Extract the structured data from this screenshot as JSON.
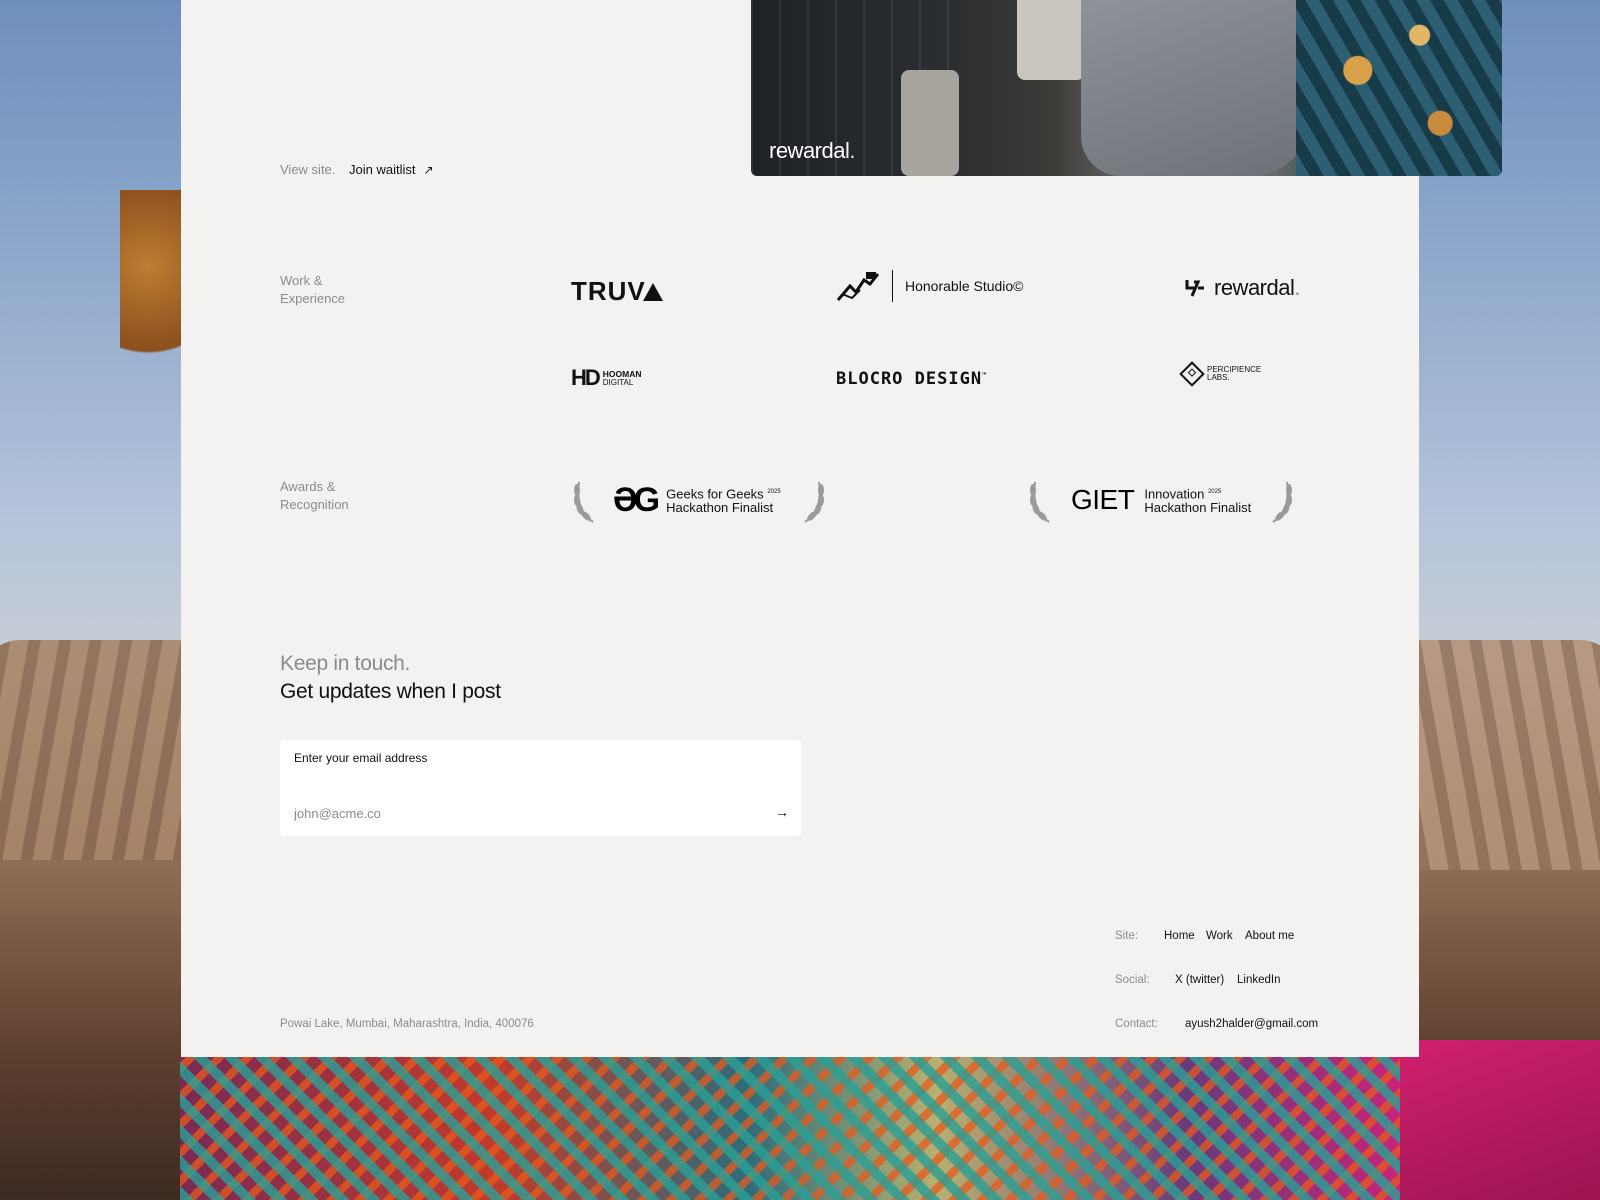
{
  "hero": {
    "brand": "rewardal",
    "brand_dot": "."
  },
  "view_site": {
    "label": "View site.",
    "link": "Join waitlist",
    "arrow_icon": "arrow-up-right-icon"
  },
  "work": {
    "label_line1": "Work &",
    "label_line2": "Experience",
    "logos": {
      "truva": "TRUV",
      "honorable": "Honorable Studio©",
      "rewardal": "rewardal",
      "rewardal_dot": ".",
      "hd_big": "HD",
      "hd_line1": "HOOMAN",
      "hd_line2": "DIGITAL",
      "blocro": "BLOCRO DESIGN",
      "blocro_tm": "™",
      "percip_line1": "PERCIPIENCE",
      "percip_line2": "LABS."
    }
  },
  "awards": {
    "label_line1": "Awards &",
    "label_line2": "Recognition",
    "items": [
      {
        "mark": "ƏG",
        "line1": "Geeks for Geeks",
        "year": "2025",
        "line2": "Hackathon Finalist"
      },
      {
        "mark": "GIET",
        "line1": "Innovation",
        "year": "2025",
        "line2": "Hackathon Finalist"
      }
    ]
  },
  "newsletter": {
    "line1": "Keep in touch.",
    "line2": "Get updates when I post",
    "input_label": "Enter your email address",
    "placeholder": "john@acme.co",
    "submit_icon": "arrow-right-icon"
  },
  "footer": {
    "address": "Powai Lake, Mumbai, Maharashtra, India, 400076",
    "site_label": "Site:",
    "site_links": [
      "Home",
      "Work",
      "About me"
    ],
    "social_label": "Social:",
    "social_links": [
      "X (twitter)",
      "LinkedIn"
    ],
    "contact_label": "Contact:",
    "email": "ayush2halder@gmail.com"
  }
}
